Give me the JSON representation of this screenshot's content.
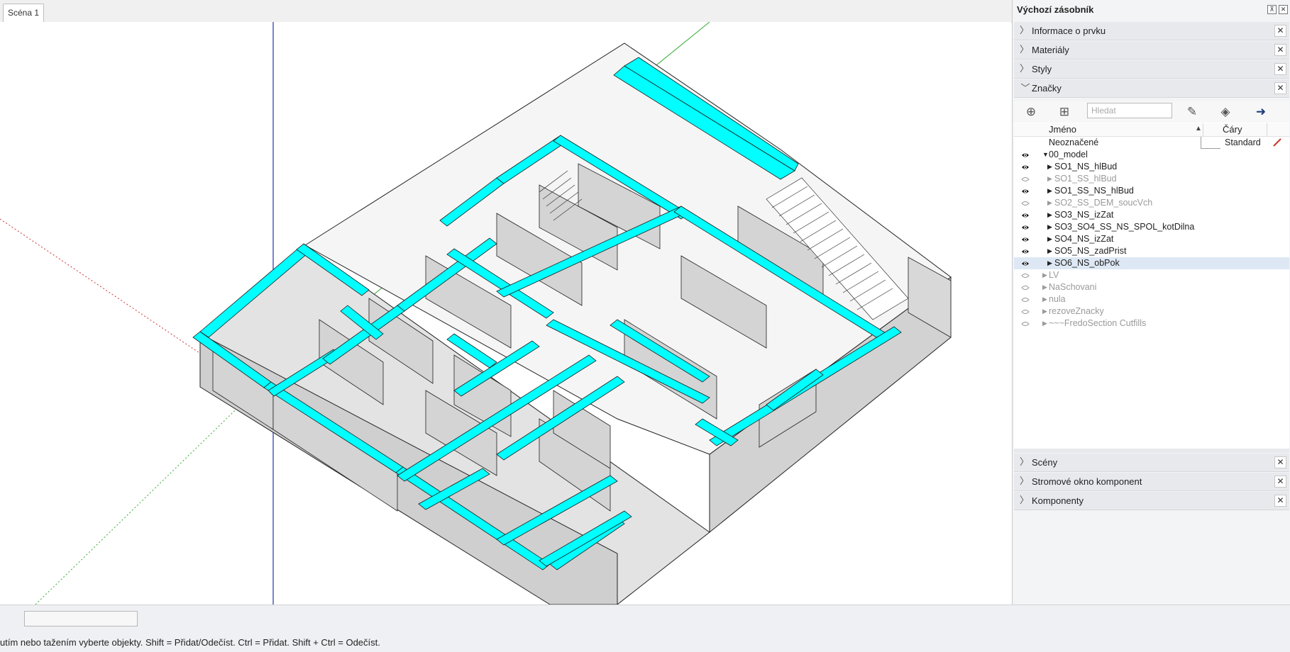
{
  "tab": {
    "label": "Scéna 1"
  },
  "status": {
    "message": "utím nebo tažením vyberte objekty. Shift = Přidat/Odečíst. Ctrl = Přidat. Shift + Ctrl = Odečíst."
  },
  "tray": {
    "title": "Výchozí zásobník",
    "pin_icon": "pin-icon",
    "close_icon": "close-icon",
    "panels_top": [
      {
        "label": "Informace o prvku",
        "close": "✕"
      },
      {
        "label": "Materiály",
        "close": "✕"
      },
      {
        "label": "Styly",
        "close": "✕"
      },
      {
        "label": "Značky",
        "close": "✕"
      }
    ],
    "panels_bottom": [
      {
        "label": "Scény",
        "close": "✕"
      },
      {
        "label": "Stromové okno komponent",
        "close": "✕"
      },
      {
        "label": "Komponenty",
        "close": "✕"
      }
    ]
  },
  "tags": {
    "search_placeholder": "Hledat",
    "col_name": "Jméno",
    "col_lines": "Čáry",
    "untagged": {
      "name": "Neoznačené",
      "lines": "Standard"
    },
    "rows": [
      {
        "name": "00_model",
        "visible": true,
        "indent": 1,
        "expanded": true
      },
      {
        "name": "SO1_NS_hlBud",
        "visible": true,
        "indent": 2
      },
      {
        "name": "SO1_SS_hlBud",
        "visible": false,
        "indent": 2
      },
      {
        "name": "SO1_SS_NS_hlBud",
        "visible": true,
        "indent": 2
      },
      {
        "name": "SO2_SS_DEM_soucVch",
        "visible": false,
        "indent": 2
      },
      {
        "name": "SO3_NS_izZat",
        "visible": true,
        "indent": 2
      },
      {
        "name": "SO3_SO4_SS_NS_SPOL_kotDilna",
        "visible": true,
        "indent": 2
      },
      {
        "name": "SO4_NS_izZat",
        "visible": true,
        "indent": 2
      },
      {
        "name": "SO5_NS_zadPrist",
        "visible": true,
        "indent": 2
      },
      {
        "name": "SO6_NS_obPok",
        "visible": true,
        "indent": 2,
        "selected": true
      },
      {
        "name": "LV",
        "visible": false,
        "indent": 1
      },
      {
        "name": "NaSchovani",
        "visible": false,
        "indent": 1
      },
      {
        "name": "nula",
        "visible": false,
        "indent": 1
      },
      {
        "name": "rezoveZnacky",
        "visible": false,
        "indent": 1
      },
      {
        "name": "~~~FredoSection Cutfills",
        "visible": false,
        "indent": 1
      }
    ]
  },
  "colors": {
    "wall_cut": "#00ffff",
    "wall_face": "#d9d9d9",
    "selection_row": "#dde8f4",
    "axis_red": "#cc3333",
    "axis_green": "#33aa33",
    "axis_blue": "#2233aa"
  }
}
